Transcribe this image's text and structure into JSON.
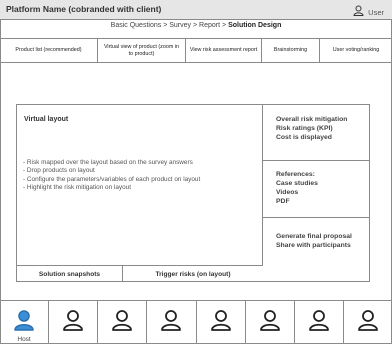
{
  "header": {
    "platform_title": "Platform Name (cobranded with client)",
    "user_label": "User"
  },
  "breadcrumb": {
    "items": [
      "Basic Questions",
      "Survey",
      "Report"
    ],
    "separator": ">",
    "current": "Solution Design"
  },
  "tabs": [
    {
      "label": "Product list (recommended)"
    },
    {
      "label": "Virtual view of product (zoom in to product)"
    },
    {
      "label": "View risk assessment report"
    },
    {
      "label": "Brainstorming"
    },
    {
      "label": "User voting/ranking"
    }
  ],
  "virtual_layout": {
    "title": "Virtual layout",
    "bullets": [
      "- Risk mapped over the layout based on the survey answers",
      "- Drop products on layout",
      "- Configure the parameters/variables of each product on layout",
      "- Highlight the risk mitigation on layout"
    ]
  },
  "right_panel": {
    "risk": [
      "Overall risk mitigation",
      "Risk ratings (KPI)",
      "Cost is displayed"
    ],
    "references": [
      "References:",
      "Case studies",
      "Videos",
      "PDF"
    ],
    "proposal": [
      "Generate final proposal",
      "Share with participants"
    ]
  },
  "actions": {
    "snapshots": "Solution snapshots",
    "trigger": "Trigger risks (on layout)"
  },
  "participants": {
    "host_label": "Host",
    "count": 8,
    "host_color": "#3a8fd8"
  }
}
